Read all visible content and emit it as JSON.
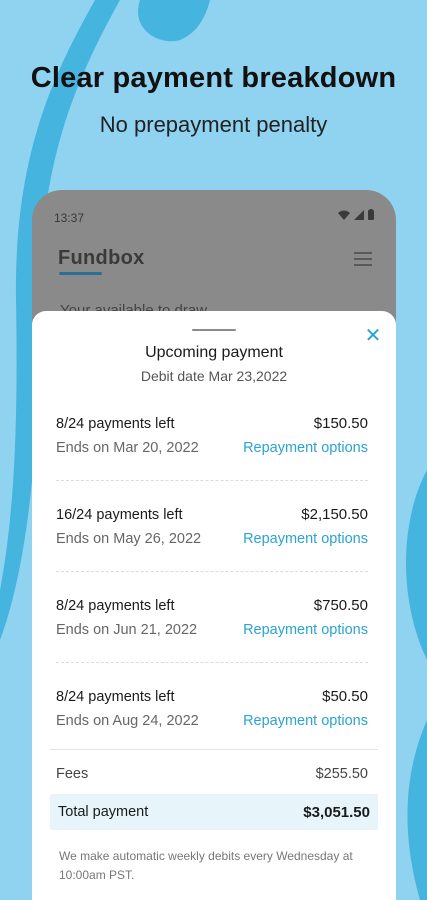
{
  "promo": {
    "headline": "Clear payment breakdown",
    "subheadline": "No prepayment penalty"
  },
  "status_bar": {
    "time": "13:37",
    "icons": [
      "wifi-icon",
      "signal-icon",
      "battery-icon"
    ]
  },
  "app": {
    "name": "Fundbox",
    "menu_icon": "hamburger-menu-icon",
    "background_partial_text": "Your available to draw"
  },
  "sheet": {
    "title": "Upcoming payment",
    "subtitle": "Debit date Mar 23,2022",
    "close_icon": "close-icon",
    "loans": [
      {
        "payments_left": "8/24 payments left",
        "amount": "$150.50",
        "ends_on": "Ends on Mar 20, 2022",
        "link": "Repayment options"
      },
      {
        "payments_left": "16/24 payments left",
        "amount": "$2,150.50",
        "ends_on": "Ends on May 26, 2022",
        "link": "Repayment options"
      },
      {
        "payments_left": "8/24 payments left",
        "amount": "$750.50",
        "ends_on": "Ends on Jun 21, 2022",
        "link": "Repayment options"
      },
      {
        "payments_left": "8/24 payments left",
        "amount": "$50.50",
        "ends_on": "Ends on Aug 24, 2022",
        "link": "Repayment options"
      }
    ],
    "fees_label": "Fees",
    "fees_value": "$255.50",
    "total_label": "Total payment",
    "total_value": "$3,051.50",
    "footnote": "We make automatic weekly debits every Wednesday at 10:00am PST."
  },
  "colors": {
    "background": "#8fd3f0",
    "swoosh": "#45b5e0",
    "accent": "#2aa4d0",
    "total_highlight": "#e7f5fb"
  }
}
